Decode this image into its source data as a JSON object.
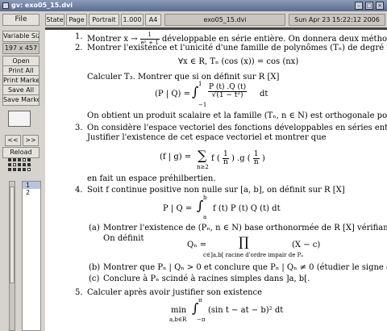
{
  "window": {
    "title": "gv: exo05_15.dvi"
  },
  "toolbar": {
    "file": "File",
    "state": "State",
    "page": "Page",
    "orientation": "Portrait",
    "zoom": "1.000",
    "paper": "A4",
    "filename": "exo05_15.dvi",
    "datetime": "Sun Apr 23 15:22:12 2006"
  },
  "sidebar": {
    "variable_size": "Variable Size",
    "dimensions": "197 x 457",
    "open": "Open",
    "print_all": "Print All",
    "print_marked": "Print Marked",
    "save_all": "Save All",
    "save_marked": "Save Marked",
    "prev": "<<",
    "next": ">>",
    "reload": "Reload",
    "pages": [
      "1",
      "2"
    ]
  },
  "document": {
    "l1_num": "1.",
    "l1_a": "Montrer x →",
    "l1_num_f": "1",
    "l1_den_f": "eˣ + 1",
    "l1_b": "développable en série entière. On donnera deux méthodes.",
    "l2_num": "2.",
    "l2": "Montrer l'existence et l'unicité d'une famille de polynômes (Tₙ) de degré n telle que",
    "eq1": "∀x ∈ R, Tₙ (cos (x)) = cos (nx)",
    "l3": "Calculer T₃. Montrer que si on définit sur R [X]",
    "eq2_lhs": "(P | Q) =",
    "eq2_int": "∫",
    "eq2_up": "1",
    "eq2_low": "−1",
    "eq2_num": "P (t) .Q (t)",
    "eq2_den": "√(1 − t²)",
    "eq2_dt": "dt",
    "l4": "On obtient un produit scalaire et la famille (Tₙ, n ∈ N) est orthogonale pour ce produit scalai",
    "l5_num": "3.",
    "l5": "On considère l'espace vectoriel des fonctions développables en séries entières sur ]−1, 1[ nulles e",
    "l6": "Justifier l'existence de cet espace vectoriel et montrer que",
    "eq3_lhs": "(f | g) =",
    "eq3_sum": "∑",
    "eq3_sub": "n≥2",
    "eq3_f": "f",
    "eq3_mid": ".g",
    "eq3_one": "1",
    "eq3_n": "n",
    "l7": "en fait un espace préhilbertien.",
    "l8_num": "4.",
    "l8": "Soit f continue positive non nulle sur [a, b], on définit sur R [X]",
    "eq4_lhs": "P | Q =",
    "eq4_int": "∫",
    "eq4_up": "b",
    "eq4_low": "a",
    "eq4_body": "f (t) P (t) Q (t) dt",
    "la": "(a)",
    "la_text": "Montrer l'existence de (Pₙ, n ∈ N) base orthonormée de R [X] vérifiant deg Pₙ = n.",
    "la2": "On définit",
    "eq5_lhs": "Qₙ =",
    "eq5_prod": "∏",
    "eq5_sub": "c∈]a,b[ racine d'ordre impair de Pₙ",
    "eq5_rhs": "(X − c)",
    "lb": "(b)",
    "lb_text": "Montrer que Pₙ | Qₙ > 0 et conclure que Pₙ | Qₙ ≠ 0 (étudier le signe du produit PₙQₙ)",
    "lc": "(c)",
    "lc_text": "Conclure à Pₙ scindé à racines simples dans ]a, b[.",
    "l9_num": "5.",
    "l9": "Calculer après avoir justifier son existence",
    "eq6_min": "min",
    "eq6_sub": "a,b∈R",
    "eq6_int": "∫",
    "eq6_up": "π",
    "eq6_low": "−π",
    "eq6_body": "(sin t − at − b)² dt"
  },
  "colors": {
    "titlebar": "#5a6c92",
    "panel": "#d6d3ce",
    "selected_page": "#b7c4dc"
  }
}
